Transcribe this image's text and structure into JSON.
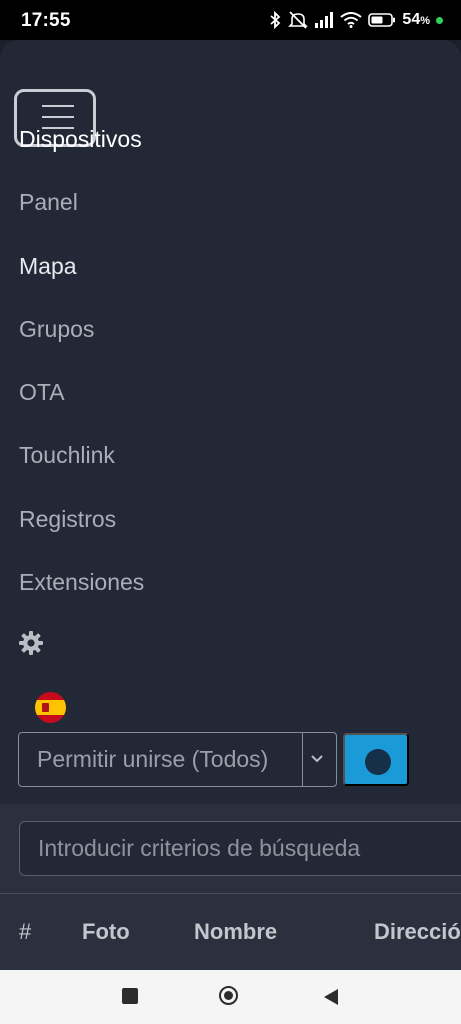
{
  "status_bar": {
    "time": "17:55",
    "battery": "54",
    "battery_unit": "%",
    "icons": [
      "bluetooth-icon",
      "mute-icon",
      "signal-icon",
      "wifi-icon",
      "battery-icon",
      "charging-dot-icon"
    ]
  },
  "nav": {
    "menu_items": [
      {
        "label": "Dispositivos",
        "state": "active"
      },
      {
        "label": "Panel"
      },
      {
        "label": "Mapa"
      },
      {
        "label": "Grupos"
      },
      {
        "label": "OTA"
      },
      {
        "label": "Touchlink"
      },
      {
        "label": "Registros"
      },
      {
        "label": "Extensiones"
      }
    ],
    "settings_icon": "gear-icon",
    "language_icon": "spain-flag-icon",
    "permit_join": {
      "selected": "Permitir unirse (Todos)"
    },
    "join_button_icon": "globe-icon"
  },
  "search": {
    "placeholder": "Introducir criterios de búsqueda"
  },
  "table": {
    "headers": [
      "#",
      "Foto",
      "Nombre",
      "Direcció"
    ]
  },
  "colors": {
    "nav_bg": "#222836",
    "content_bg": "#2a303d",
    "accent": "#1a9ad6",
    "email_link": "#3a7fd5"
  }
}
